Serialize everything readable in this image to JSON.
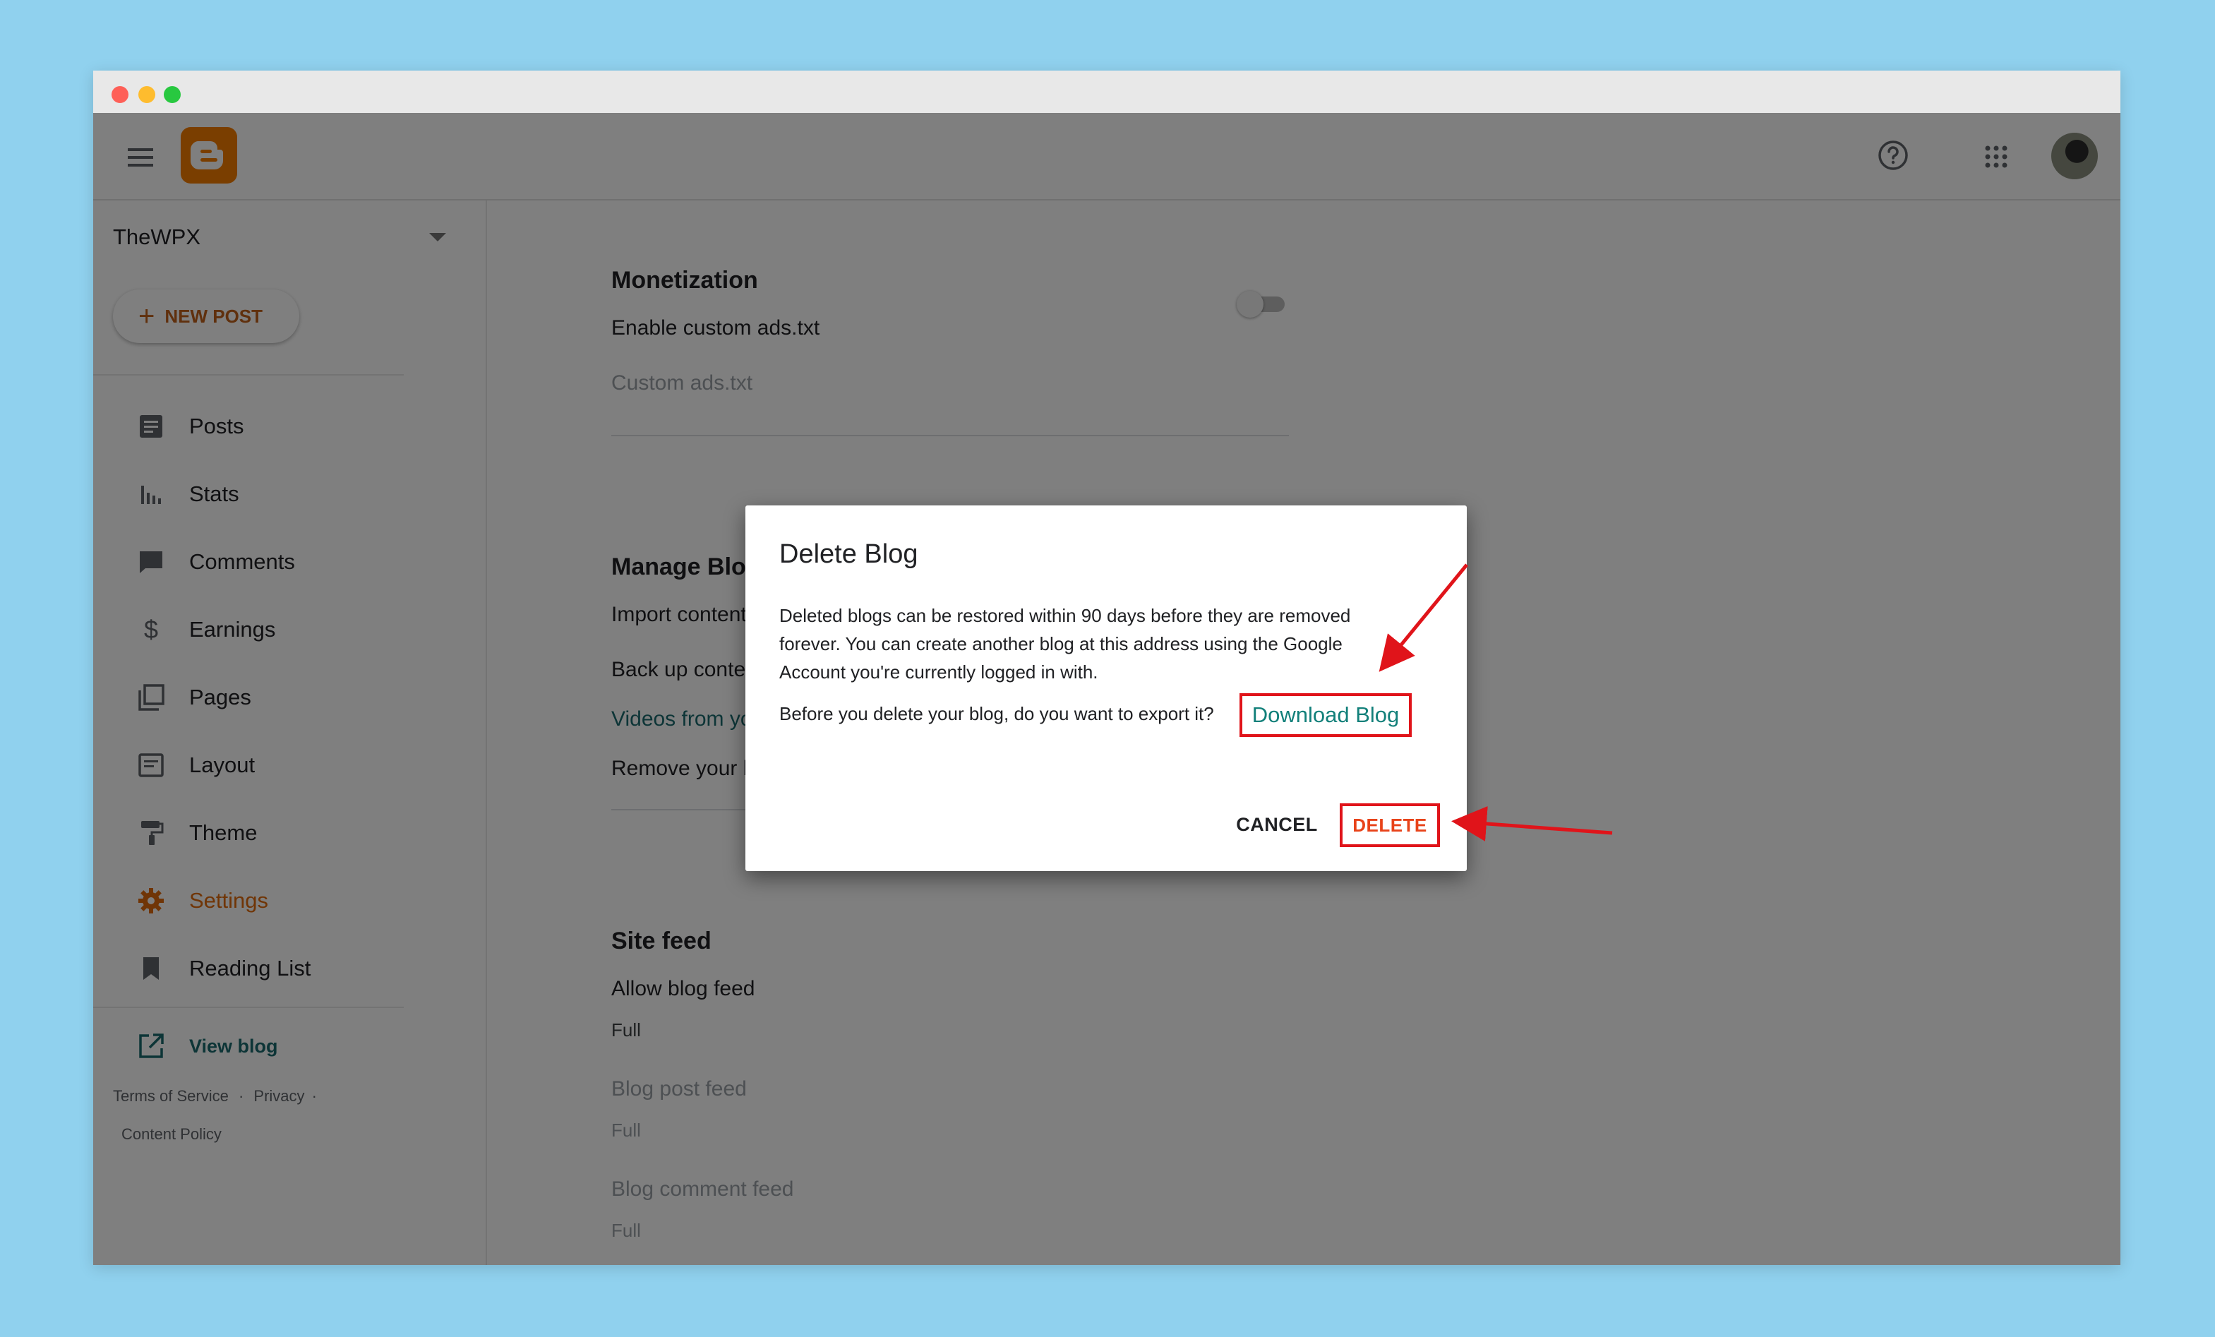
{
  "app": {
    "blog_name": "TheWPX",
    "new_post_label": "NEW POST"
  },
  "sidebar": {
    "items": [
      {
        "label": "Posts",
        "icon": "posts-icon"
      },
      {
        "label": "Stats",
        "icon": "stats-icon"
      },
      {
        "label": "Comments",
        "icon": "comments-icon"
      },
      {
        "label": "Earnings",
        "icon": "earnings-icon"
      },
      {
        "label": "Pages",
        "icon": "pages-icon"
      },
      {
        "label": "Layout",
        "icon": "layout-icon"
      },
      {
        "label": "Theme",
        "icon": "theme-icon"
      },
      {
        "label": "Settings",
        "icon": "gear-icon",
        "active": true
      },
      {
        "label": "Reading List",
        "icon": "bookmark-icon"
      }
    ],
    "view_blog": "View blog",
    "footer": {
      "terms": "Terms of Service",
      "privacy": "Privacy",
      "content_policy": "Content Policy",
      "separator": "·"
    }
  },
  "main": {
    "monetization": {
      "title": "Monetization",
      "enable_ads_label": "Enable custom ads.txt",
      "enable_ads_on": false,
      "custom_ads_label": "Custom ads.txt"
    },
    "manage_blog": {
      "title": "Manage Blog",
      "import": "Import content",
      "backup": "Back up content",
      "videos": "Videos from your blog",
      "remove": "Remove your blog"
    },
    "site_feed": {
      "title": "Site feed",
      "allow_feed": "Allow blog feed",
      "allow_feed_value": "Full",
      "post_feed": "Blog post feed",
      "post_feed_value": "Full",
      "comment_feed": "Blog comment feed",
      "comment_feed_value": "Full"
    }
  },
  "dialog": {
    "title": "Delete Blog",
    "body": "Deleted blogs can be restored within 90 days before they are removed forever. You can create another blog at this address using the Google Account you're currently logged in with.",
    "export_prompt": "Before you delete your blog, do you want to export it?",
    "download_link": "Download Blog",
    "cancel": "CANCEL",
    "delete": "DELETE"
  },
  "colors": {
    "accent": "#f57d00",
    "highlight": "#e0141a",
    "link": "#12807a",
    "background": "#90d1ee"
  }
}
